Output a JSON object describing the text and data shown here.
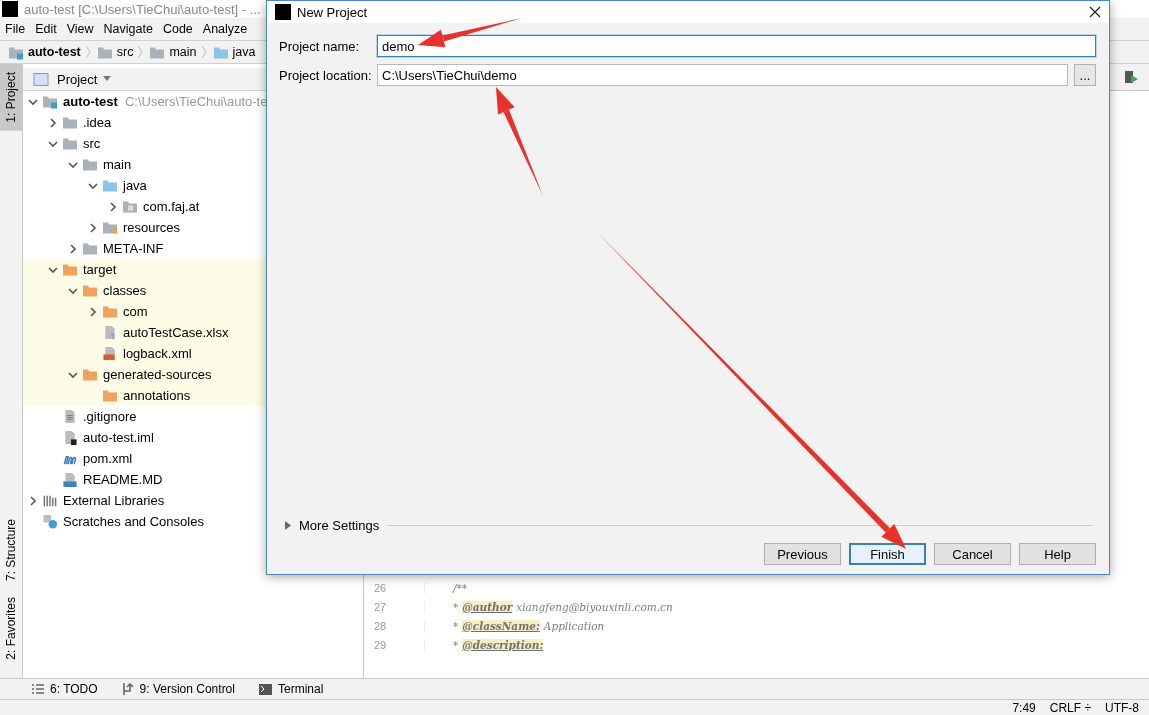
{
  "window": {
    "title": "auto-test [C:\\Users\\TieChui\\auto-test] - ..."
  },
  "menu": [
    "File",
    "Edit",
    "View",
    "Navigate",
    "Code",
    "Analyze"
  ],
  "breadcrumbs": [
    {
      "label": "auto-test",
      "kind": "module"
    },
    {
      "label": "src",
      "kind": "folder"
    },
    {
      "label": "main",
      "kind": "folder"
    },
    {
      "label": "java",
      "kind": "source"
    }
  ],
  "left_tabs": [
    {
      "label": "1: Project",
      "selected": true
    },
    {
      "label": "7: Structure",
      "selected": false
    },
    {
      "label": "2: Favorites",
      "selected": false
    }
  ],
  "project_panel": {
    "title": "Project",
    "tree": [
      {
        "label": "auto-test",
        "path": "C:\\Users\\TieChui\\auto-te",
        "kind": "module",
        "expanded": true,
        "children": [
          {
            "label": ".idea",
            "kind": "folder",
            "expanded": false
          },
          {
            "label": "src",
            "kind": "folder",
            "expanded": true,
            "children": [
              {
                "label": "main",
                "kind": "folder",
                "expanded": true,
                "children": [
                  {
                    "label": "java",
                    "kind": "source",
                    "expanded": true,
                    "children": [
                      {
                        "label": "com.faj.at",
                        "kind": "package",
                        "expanded": false
                      }
                    ]
                  },
                  {
                    "label": "resources",
                    "kind": "resources",
                    "expanded": false
                  }
                ]
              },
              {
                "label": "META-INF",
                "kind": "folder",
                "expanded": false
              }
            ]
          },
          {
            "label": "target",
            "kind": "excluded",
            "expanded": true,
            "highlighted": true,
            "children": [
              {
                "label": "classes",
                "kind": "excluded",
                "expanded": true,
                "children": [
                  {
                    "label": "com",
                    "kind": "excluded",
                    "expanded": false
                  },
                  {
                    "label": "autoTestCase.xlsx",
                    "kind": "unknown"
                  },
                  {
                    "label": "logback.xml",
                    "kind": "xml"
                  }
                ]
              },
              {
                "label": "generated-sources",
                "kind": "excluded",
                "expanded": true,
                "children": [
                  {
                    "label": "annotations",
                    "kind": "excluded"
                  }
                ]
              }
            ]
          },
          {
            "label": ".gitignore",
            "kind": "text"
          },
          {
            "label": "auto-test.iml",
            "kind": "iml"
          },
          {
            "label": "pom.xml",
            "kind": "maven"
          },
          {
            "label": "README.MD",
            "kind": "markdown"
          }
        ]
      },
      {
        "label": "External Libraries",
        "kind": "libraries",
        "expanded": false
      },
      {
        "label": "Scratches and Consoles",
        "kind": "scratches"
      }
    ]
  },
  "editor": {
    "lines": [
      {
        "number": "26",
        "lead": "/**"
      },
      {
        "number": "27",
        "lead": "*",
        "tag": "@author",
        "text": "xiangfeng@biyouxinli.com.cn"
      },
      {
        "number": "28",
        "lead": "*",
        "tag": "@className:",
        "text": "Application"
      },
      {
        "number": "29",
        "lead": "*",
        "tag": "@description:"
      }
    ]
  },
  "bottom_tabs": [
    {
      "label": "6: TODO",
      "kind": "list"
    },
    {
      "label": "9: Version Control",
      "kind": "vcs"
    },
    {
      "label": "Terminal",
      "kind": "terminal"
    }
  ],
  "status_bar": [
    "7:49",
    "CRLF ÷",
    "UTF-8"
  ],
  "dialog": {
    "title": "New Project",
    "fields": [
      {
        "label": "Project name:",
        "value": "demo",
        "focused": true
      },
      {
        "label": "Project location:",
        "value": "C:\\Users\\TieChui\\demo",
        "focused": false,
        "browse_label": "..."
      }
    ],
    "more_settings": {
      "label": "More Settings",
      "expanded": false
    },
    "buttons": [
      {
        "label": "Previous",
        "default": false
      },
      {
        "label": "Finish",
        "default": true
      },
      {
        "label": "Cancel",
        "default": false
      },
      {
        "label": "Help",
        "default": false
      }
    ]
  }
}
